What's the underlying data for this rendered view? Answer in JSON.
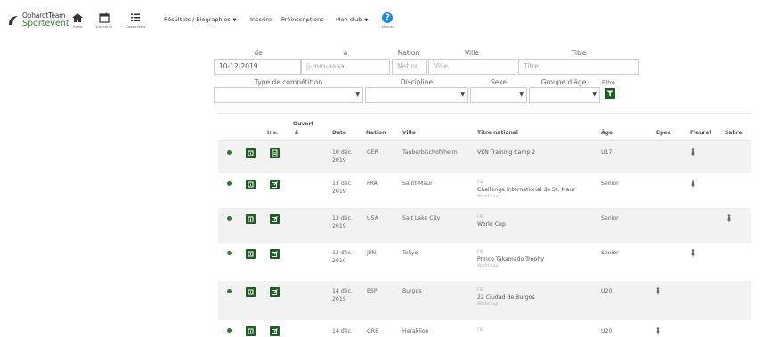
{
  "brand": {
    "line1": "OphardtTeam",
    "line2": "Sportevent"
  },
  "nav": {
    "icons": [
      {
        "name": "home-icon",
        "label": "Home"
      },
      {
        "name": "calendar-icon",
        "label": "Calendrier"
      },
      {
        "name": "list-icon",
        "label": "Classements"
      }
    ],
    "menu": [
      {
        "label": "Résultats / Biographies",
        "dropdown": true
      },
      {
        "label": "Inscrire",
        "dropdown": false
      },
      {
        "label": "Préinscriptions",
        "dropdown": false
      },
      {
        "label": "Mon club",
        "dropdown": true
      }
    ],
    "help": {
      "icon": "question-circle-icon",
      "label": "Manuel"
    }
  },
  "filters": {
    "de": {
      "label": "de",
      "value": "10-12-2019"
    },
    "a": {
      "label": "à",
      "placeholder": "jj-mm-aaaa"
    },
    "nation": {
      "label": "Nation",
      "placeholder": "Nation"
    },
    "ville": {
      "label": "Ville",
      "placeholder": "Ville"
    },
    "titre": {
      "label": "Titre",
      "placeholder": "Titre"
    },
    "type": {
      "label": "Type de compétition",
      "value": ""
    },
    "discipline": {
      "label": "Discipline",
      "value": ""
    },
    "sexe": {
      "label": "Sexe",
      "value": ""
    },
    "age": {
      "label": "Groupe d'âge",
      "value": ""
    },
    "filtre": {
      "label": "Filtre",
      "icon": "filter-icon"
    }
  },
  "table": {
    "headers": {
      "inv": "Inv.",
      "ouvert1": "Ouvert",
      "ouvert2": "à",
      "date": "Date",
      "nation": "Nation",
      "ville": "Ville",
      "titre": "Titre national",
      "age": "Âge",
      "epee": "Epee",
      "fleuret": "Fleuret",
      "sabre": "Sabre"
    },
    "rows": [
      {
        "date1": "10 déc.",
        "date2": "2019",
        "nation": "GER",
        "ville": "Tauberbischofsheim",
        "fie": "",
        "title": "VKN Training Camp 2",
        "sub": "",
        "age": "U17",
        "weapon": "fleuret"
      },
      {
        "date1": "13 déc.",
        "date2": "2019",
        "nation": "FRA",
        "ville": "Saint-Maur",
        "fie": "FIE",
        "title": "Challenge International de St. Maur",
        "sub": "World Cup",
        "age": "Senior",
        "weapon": "fleuret"
      },
      {
        "date1": "13 déc.",
        "date2": "2019",
        "nation": "USA",
        "ville": "Salt Lake City",
        "fie": "FIE",
        "title": "World Cup",
        "sub": "",
        "age": "Senior",
        "weapon": "sabre"
      },
      {
        "date1": "13 déc.",
        "date2": "2019",
        "nation": "JPN",
        "ville": "Tokyo",
        "fie": "FIE",
        "title": "Prince Takamado Trophy",
        "sub": "World Cup",
        "age": "Senior",
        "weapon": "fleuret"
      },
      {
        "date1": "14 déc.",
        "date2": "2019",
        "nation": "ESP",
        "ville": "Burgos",
        "fie": "FIE",
        "title": "22 Ciudad de Burgos",
        "sub": "World Cup",
        "age": "U20",
        "weapon": "epee"
      },
      {
        "date1": "14 déc.",
        "date2": "",
        "nation": "GRE",
        "ville": "Heraklion",
        "fie": "FIE",
        "title": "",
        "sub": "",
        "age": "U20",
        "weapon": "epee"
      }
    ]
  },
  "colors": {
    "accent": "#1b5e20",
    "status": "#2e7d32",
    "help": "#1e88e5",
    "stripe": "#f2f2f2"
  }
}
